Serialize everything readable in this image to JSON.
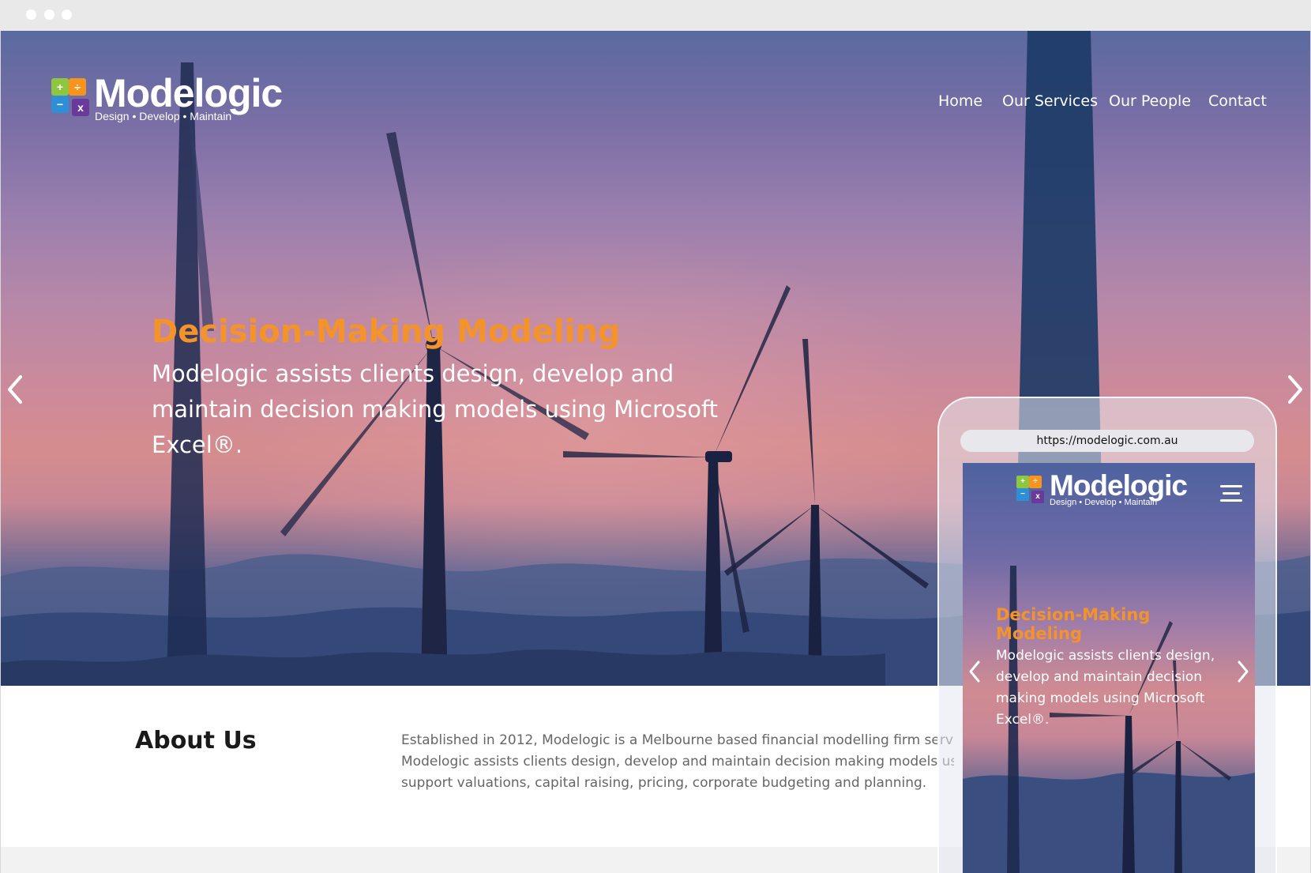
{
  "brand": {
    "name": "Modelogic",
    "tagline": "Design • Develop • Maintain",
    "logo_symbols": [
      "+",
      "÷",
      "−",
      "x"
    ],
    "logo_colors": [
      "#8dc63f",
      "#f7941d",
      "#2e8fd6",
      "#6a3a9a"
    ]
  },
  "nav": {
    "items": [
      {
        "label": "Home"
      },
      {
        "label": "Our Services"
      },
      {
        "label": "Our People"
      },
      {
        "label": "Contact"
      }
    ]
  },
  "hero": {
    "title": "Decision-Making Modeling",
    "body": "Modelogic assists clients design, develop and maintain decision making models using Microsoft Excel®.",
    "prev_icon": "chevron-left-icon",
    "next_icon": "chevron-right-icon"
  },
  "about": {
    "title": "About Us",
    "lines": [
      "Established in 2012, Modelogic is a Melbourne based financial modelling firm servicing",
      "Modelogic assists clients design, develop and maintain decision making models using M",
      "support valuations, capital raising, pricing, corporate budgeting and planning."
    ]
  },
  "phone": {
    "url": "https://modelogic.com.au",
    "menu_icon": "hamburger-menu-icon",
    "title": "Decision-Making Modeling",
    "body": "Modelogic assists clients design, develop and maintain decision making models using Microsoft Excel®."
  },
  "colors": {
    "accent_orange": "#f3932a",
    "text_white": "#ffffff",
    "about_heading": "#1a1a1a",
    "about_text": "#666666"
  }
}
